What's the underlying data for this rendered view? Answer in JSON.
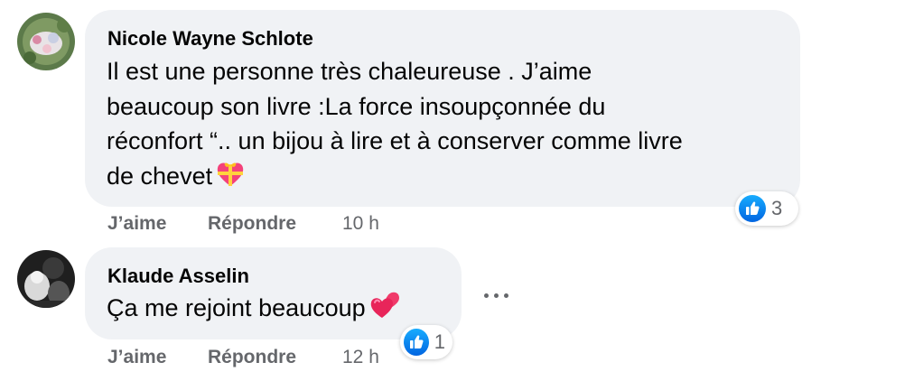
{
  "comments": [
    {
      "author": "Nicole Wayne Schlote",
      "text_lines": [
        "Il est une personne très chaleureuse . J’aime",
        "beaucoup son livre :La force insoupçonnée du",
        "réconfort “.. un bijou à lire et à conserver comme livre",
        "de chevet"
      ],
      "trailing_emoji": "gift-heart-emoji",
      "actions": {
        "like": "J’aime",
        "reply": "Répondre",
        "time": "10 h"
      },
      "reaction": {
        "icon": "like-icon",
        "count": "3"
      }
    },
    {
      "author": "Klaude Asselin",
      "text_lines": [
        "Ça me rejoint beaucoup"
      ],
      "trailing_emoji": "two-hearts-emoji",
      "actions": {
        "like": "J’aime",
        "reply": "Répondre",
        "time": "12 h"
      },
      "reaction": {
        "icon": "like-icon",
        "count": "1"
      },
      "more_icon": "more-horizontal-icon"
    }
  ],
  "colors": {
    "bubble": "#f0f2f5",
    "secondary_text": "#65676b",
    "like_blue": "#1877f2"
  }
}
